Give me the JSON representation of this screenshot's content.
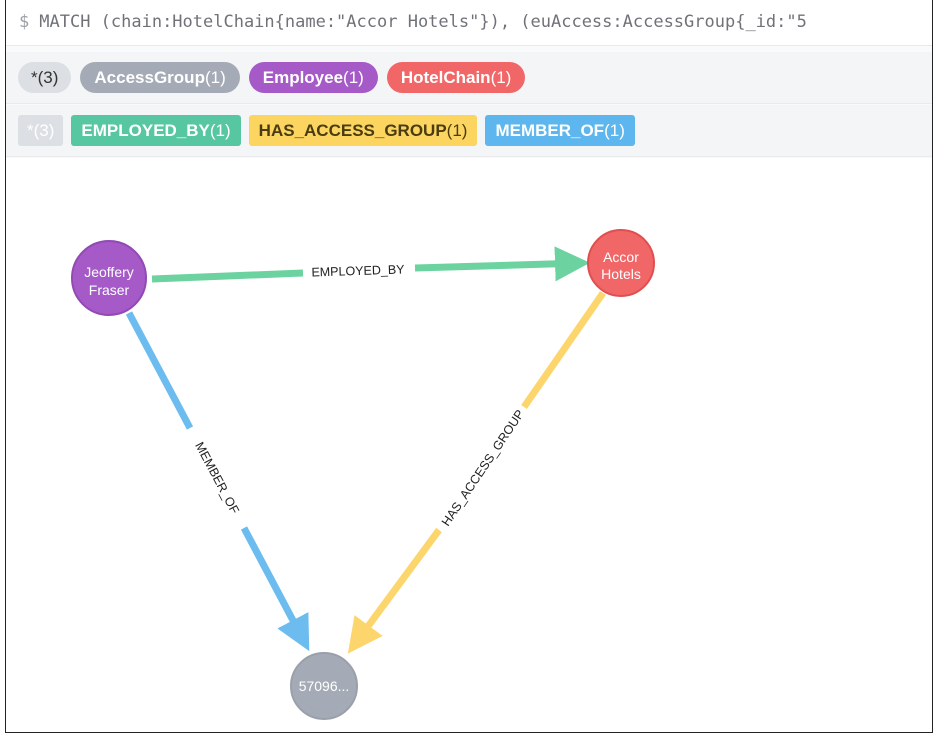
{
  "query": {
    "prompt": "$",
    "text": "MATCH (chain:HotelChain{name:\"Accor Hotels\"}), (euAccess:AccessGroup{_id:\"5"
  },
  "node_labels": [
    {
      "label": "*",
      "count": "(3)",
      "color": "#dcdfe3"
    },
    {
      "label": "AccessGroup",
      "count": "(1)",
      "color": "#a5abb6"
    },
    {
      "label": "Employee",
      "count": "(1)",
      "color": "#a55ac7"
    },
    {
      "label": "HotelChain",
      "count": "(1)",
      "color": "#f16667"
    }
  ],
  "rel_types": [
    {
      "label": "*",
      "count": "(3)",
      "color": "#dcdfe3"
    },
    {
      "label": "EMPLOYED_BY",
      "count": "(1)",
      "color": "#57c7a1"
    },
    {
      "label": "HAS_ACCESS_GROUP",
      "count": "(1)",
      "color": "#fbd560",
      "text_color": "#4a3c10"
    },
    {
      "label": "MEMBER_OF",
      "count": "(1)",
      "color": "#5db6ed"
    }
  ],
  "graph": {
    "nodes": [
      {
        "id": "employee",
        "line1": "Jeoffery",
        "line2": "Fraser",
        "color": "#a55ac7",
        "stroke": "#9249b4"
      },
      {
        "id": "hotel",
        "line1": "Accor",
        "line2": "Hotels",
        "color": "#f16667",
        "stroke": "#e04f50"
      },
      {
        "id": "group",
        "line1": "57096...",
        "line2": "",
        "color": "#a5abb6",
        "stroke": "#9aa0aa"
      }
    ],
    "edges": [
      {
        "from": "employee",
        "to": "hotel",
        "label": "EMPLOYED_BY",
        "color": "#6cd3a0"
      },
      {
        "from": "employee",
        "to": "group",
        "label": "MEMBER_OF",
        "color": "#6cbcef"
      },
      {
        "from": "hotel",
        "to": "group",
        "label": "HAS_ACCESS_GROUP",
        "color": "#fcd56d"
      }
    ]
  }
}
